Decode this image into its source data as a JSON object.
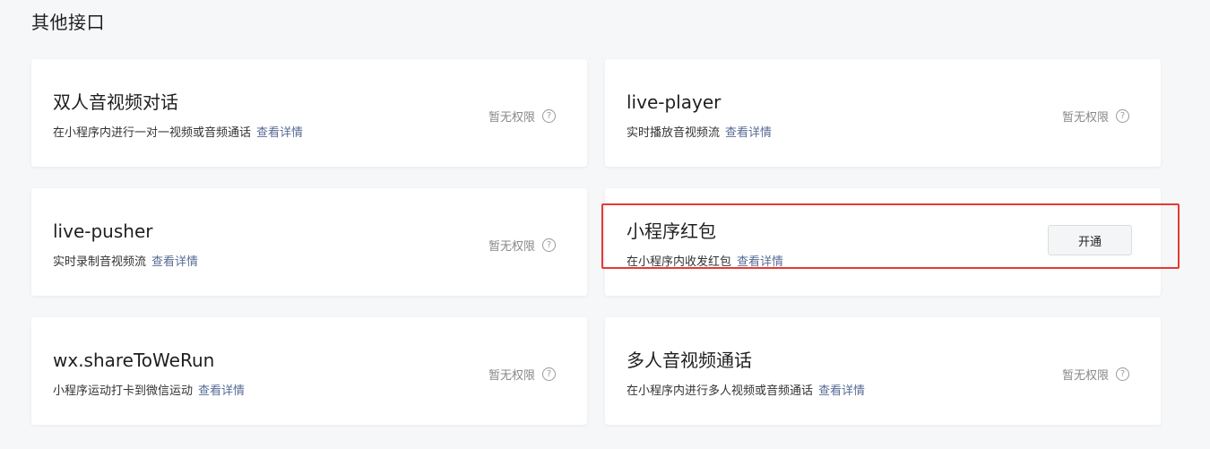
{
  "section": {
    "title": "其他接口"
  },
  "cards": [
    {
      "name": "双人音视频对话",
      "desc": "在小程序内进行一对一视频或音频通话",
      "link": "查看详情",
      "status": "暂无权限",
      "help": "?"
    },
    {
      "name": "live-player",
      "desc": "实时播放音视频流",
      "link": "查看详情",
      "status": "暂无权限",
      "help": "?"
    },
    {
      "name": "live-pusher",
      "desc": "实时录制音视频流",
      "link": "查看详情",
      "status": "暂无权限",
      "help": "?"
    },
    {
      "name": "小程序红包",
      "desc": "在小程序内收发红包",
      "link": "查看详情",
      "button": "开通"
    },
    {
      "name": "wx.shareToWeRun",
      "desc": "小程序运动打卡到微信运动",
      "link": "查看详情",
      "status": "暂无权限",
      "help": "?"
    },
    {
      "name": "多人音视频通话",
      "desc": "在小程序内进行多人视频或音频通话",
      "link": "查看详情",
      "status": "暂无权限",
      "help": "?"
    }
  ],
  "colors": {
    "link": "#576b95",
    "highlight": "#e53a32",
    "background": "#f6f7f9"
  }
}
